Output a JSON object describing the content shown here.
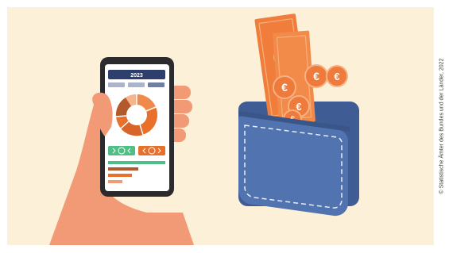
{
  "phone_screen": {
    "year": "2023"
  },
  "credit": {
    "text": "© Statistische Ämter des Bundes und der Länder, 2022"
  },
  "colors": {
    "background": "#fcf1d8",
    "phone_body": "#2b2b2d",
    "phone_header": "#2e3f6e",
    "donut_orange": "#e8702a",
    "donut_brown": "#b35a2c",
    "donut_peach": "#f4b48e",
    "green_button": "#4fbf87",
    "orange_button": "#e8702a",
    "hand": "#f29a76",
    "wallet_blue": "#4e6fa9",
    "banknote": "#f07d3c",
    "coin": "#ee7a3c"
  },
  "icons": {
    "coin": "euro-coin-icon",
    "banknote": "banknote-icon",
    "wallet": "wallet-icon",
    "phone": "smartphone-icon"
  }
}
